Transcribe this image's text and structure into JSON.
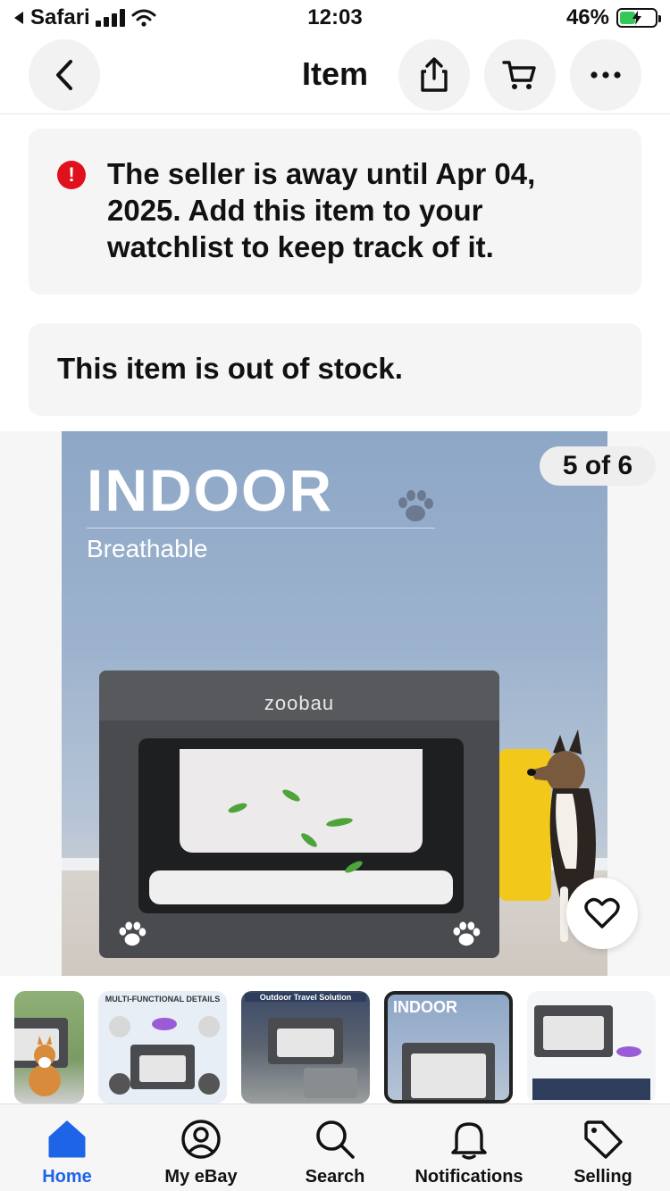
{
  "status_bar": {
    "back_app": "Safari",
    "time": "12:03",
    "battery": "46%",
    "battery_level": 0.46
  },
  "nav": {
    "title": "Item",
    "icons": [
      "back-icon",
      "share-icon",
      "cart-icon",
      "more-icon"
    ]
  },
  "notices": {
    "away": "The seller is away until Apr 04, 2025. Add this item to your watchlist to keep track of it.",
    "stock": "This item is out of stock."
  },
  "gallery": {
    "counter": "5 of 6",
    "current_index": 5,
    "total": 6,
    "hero": {
      "headline": "INDOOR",
      "subline": "Breathable",
      "brand": "zoobau"
    },
    "thumbnails": [
      {
        "caption": ""
      },
      {
        "caption": "MULTI-FUNCTIONAL DETAILS"
      },
      {
        "caption": "Outdoor Travel Solution"
      },
      {
        "caption": "INDOOR"
      },
      {
        "caption": ""
      }
    ]
  },
  "tabbar": {
    "items": [
      {
        "label": "Home",
        "icon": "home-icon",
        "active": true
      },
      {
        "label": "My eBay",
        "icon": "user-icon",
        "active": false
      },
      {
        "label": "Search",
        "icon": "search-icon",
        "active": false
      },
      {
        "label": "Notifications",
        "icon": "bell-icon",
        "active": false
      },
      {
        "label": "Selling",
        "icon": "tag-icon",
        "active": false
      }
    ]
  },
  "colors": {
    "accent": "#1e64e6",
    "alert": "#e0101c",
    "banner_bg": "#f5f5f5"
  }
}
